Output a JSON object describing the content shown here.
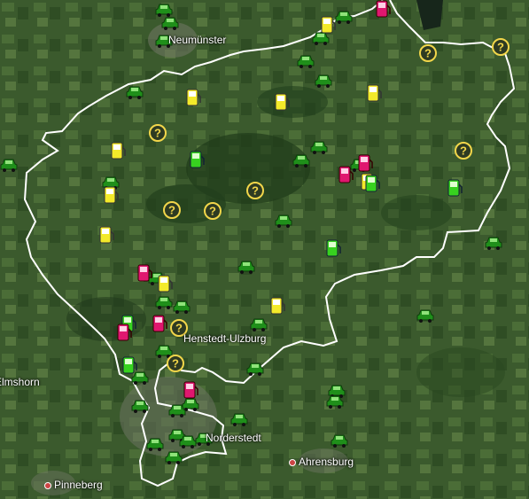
{
  "map": {
    "labels": [
      {
        "text": "Neumünster",
        "name": "label-neumuenster"
      },
      {
        "text": "Henstedt-Ulzburg",
        "name": "label-henstedt-ulzburg"
      },
      {
        "text": "Norderstedt",
        "name": "label-norderstedt"
      },
      {
        "text": "Ahrensburg",
        "name": "label-ahrensburg"
      },
      {
        "text": "Pinneberg",
        "name": "label-pinneberg"
      },
      {
        "text": "Elmshorn",
        "name": "label-elmshorn"
      }
    ],
    "marker_types": {
      "taxi": "green car icon",
      "station_yellow": "yellow fuel pump icon",
      "station_green": "green fuel pump icon",
      "station_pink": "pink fuel pump icon",
      "unknown": "question mark icon"
    },
    "colors": {
      "boundary": "#ffffff",
      "taxi": "#1f8f1a",
      "yellow": "#f3ea2a",
      "green_pump": "#37d21f",
      "pink": "#e0176f",
      "unknown": "#f2d64a"
    }
  }
}
